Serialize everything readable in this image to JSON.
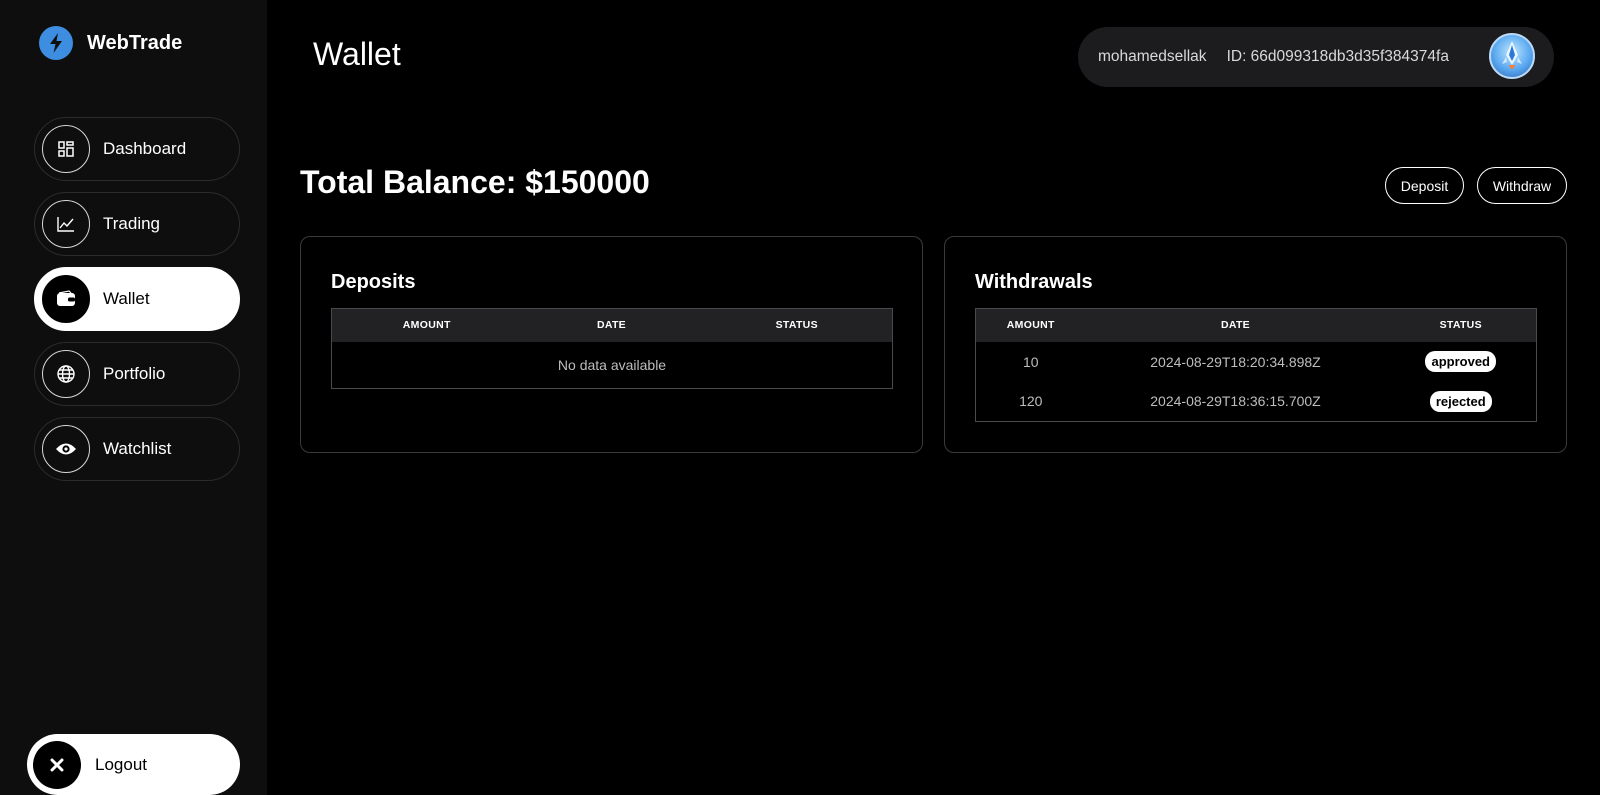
{
  "brand": {
    "name": "WebTrade",
    "logo_icon": "lightning-icon",
    "logo_color": "#3d8ee0"
  },
  "sidebar": {
    "items": [
      {
        "label": "Dashboard",
        "icon": "dashboard-grid-icon",
        "active": false
      },
      {
        "label": "Trading",
        "icon": "chart-line-icon",
        "active": false
      },
      {
        "label": "Wallet",
        "icon": "wallet-icon",
        "active": true
      },
      {
        "label": "Portfolio",
        "icon": "globe-icon",
        "active": false
      },
      {
        "label": "Watchlist",
        "icon": "eye-icon",
        "active": false
      }
    ],
    "logout": {
      "label": "Logout",
      "icon": "close-icon"
    }
  },
  "header": {
    "title": "Wallet",
    "user": {
      "username": "mohamedsellak",
      "id_text": "ID: 66d099318db3d35f384374fa",
      "avatar_icon": "rocket-avatar-icon"
    }
  },
  "balance": {
    "text": "Total Balance: $150000"
  },
  "actions": {
    "deposit_label": "Deposit",
    "withdraw_label": "Withdraw"
  },
  "deposits": {
    "title": "Deposits",
    "columns": [
      "AMOUNT",
      "DATE",
      "STATUS"
    ],
    "empty_text": "No data available",
    "rows": []
  },
  "withdrawals": {
    "title": "Withdrawals",
    "columns": [
      "AMOUNT",
      "DATE",
      "STATUS"
    ],
    "rows": [
      {
        "amount": "10",
        "date": "2024-08-29T18:20:34.898Z",
        "status": "approved"
      },
      {
        "amount": "120",
        "date": "2024-08-29T18:36:15.700Z",
        "status": "rejected"
      }
    ]
  },
  "colors": {
    "background": "#000000",
    "sidebar": "#0e0e0f",
    "accent": "#3d8ee0",
    "pill": "#1c1c1e"
  }
}
